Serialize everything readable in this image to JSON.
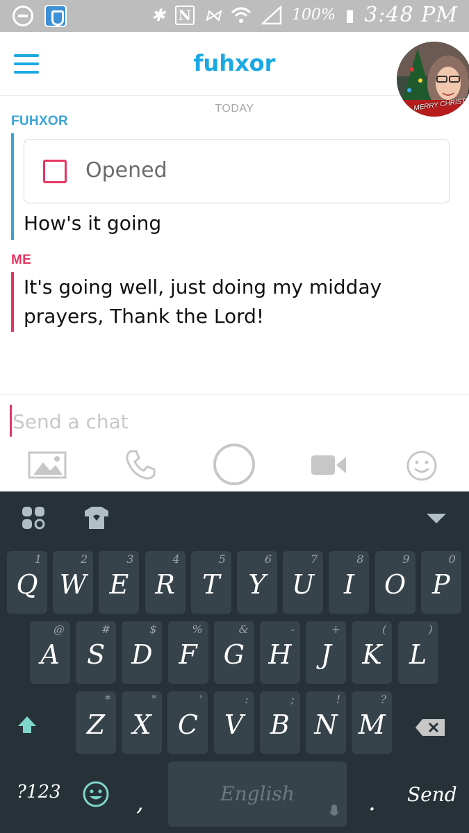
{
  "status_bar": {
    "battery": "100%",
    "time": "3:48 PM"
  },
  "header": {
    "title": "fuhxor",
    "avatar_caption": "MERRY CHRISTMAS"
  },
  "chat": {
    "date_label": "TODAY",
    "messages": [
      {
        "sender": "FUHXOR",
        "status": "Opened",
        "text": "How's it going"
      },
      {
        "sender": "ME",
        "text": "It's going well, just doing my midday prayers, Thank the Lord!"
      }
    ]
  },
  "input": {
    "placeholder": "Send a chat"
  },
  "colors": {
    "accent_blue": "#1aa9e3",
    "accent_red": "#e53563",
    "keyboard_bg": "#263238",
    "key_bg": "#37434a",
    "shift_teal": "#7fd6cc"
  },
  "keyboard": {
    "row1": [
      {
        "letter": "Q",
        "hint": "1"
      },
      {
        "letter": "W",
        "hint": "2"
      },
      {
        "letter": "E",
        "hint": "3"
      },
      {
        "letter": "R",
        "hint": "4"
      },
      {
        "letter": "T",
        "hint": "5"
      },
      {
        "letter": "Y",
        "hint": "6"
      },
      {
        "letter": "U",
        "hint": "7"
      },
      {
        "letter": "I",
        "hint": "8"
      },
      {
        "letter": "O",
        "hint": "9"
      },
      {
        "letter": "P",
        "hint": "0"
      }
    ],
    "row2": [
      {
        "letter": "A",
        "hint": "@"
      },
      {
        "letter": "S",
        "hint": "#"
      },
      {
        "letter": "D",
        "hint": "$"
      },
      {
        "letter": "F",
        "hint": "%"
      },
      {
        "letter": "G",
        "hint": "&"
      },
      {
        "letter": "H",
        "hint": "-"
      },
      {
        "letter": "J",
        "hint": "+"
      },
      {
        "letter": "K",
        "hint": "("
      },
      {
        "letter": "L",
        "hint": ")"
      }
    ],
    "row3": [
      {
        "letter": "Z",
        "hint": "*"
      },
      {
        "letter": "X",
        "hint": "\""
      },
      {
        "letter": "C",
        "hint": "'"
      },
      {
        "letter": "V",
        "hint": ":"
      },
      {
        "letter": "B",
        "hint": ";"
      },
      {
        "letter": "N",
        "hint": "!"
      },
      {
        "letter": "M",
        "hint": "?"
      }
    ],
    "symbols_label": "?123",
    "comma": ",",
    "period": ".",
    "space_label": "English",
    "enter_label": "Send"
  }
}
